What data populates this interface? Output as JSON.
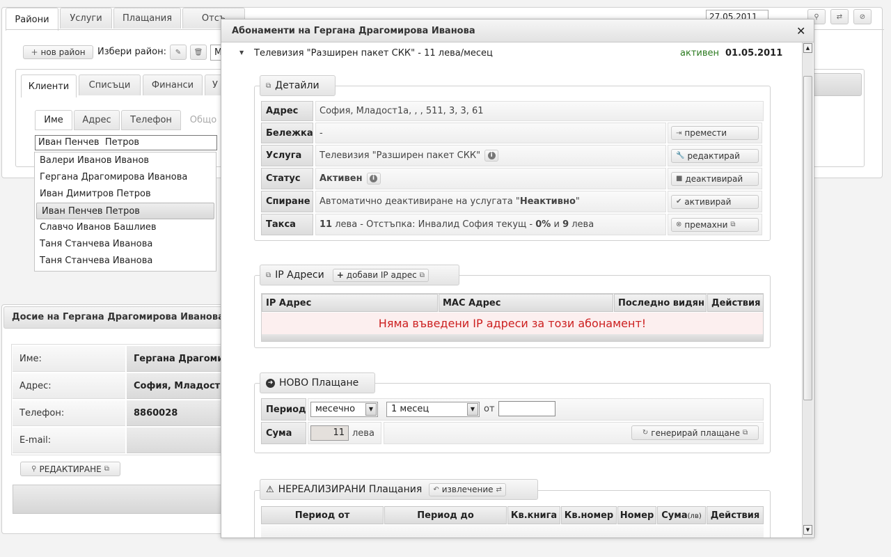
{
  "topTabs": [
    "Райони",
    "Услуги",
    "Плащания",
    "Отсъ"
  ],
  "topDate": "27.05.2011",
  "districtToolbar": {
    "newDistrict": "нов район",
    "chooseDistrict": "Избери район:",
    "selectValue": "М"
  },
  "innerTabs": [
    "Клиенти",
    "Списъци",
    "Финанси",
    "У"
  ],
  "searchTabs": [
    "Име",
    "Адрес",
    "Телефон",
    "Общо"
  ],
  "search": {
    "value": "Иван Пенчев  Петров"
  },
  "autocomplete": [
    "Валери Иванов Иванов",
    "Гергана Драгомирова Иванова",
    "Иван Димитров Петров",
    "Иван Пенчев Петров",
    "Славчо Иванов Башлиев",
    "Таня Станчева Иванова",
    "Таня Станчева Иванова"
  ],
  "dossier": {
    "title": "Досие на Гергана Драгомирова Иванова",
    "rows": [
      {
        "label": "Име:",
        "value": "Гергана Драгоми"
      },
      {
        "label": "Адрес:",
        "value": "София, Младост"
      },
      {
        "label": "Телефон:",
        "value": "8860028"
      },
      {
        "label": "E-mail:",
        "value": ""
      }
    ],
    "editLabel": "РЕДАКТИРАНЕ"
  },
  "modal": {
    "title": "Абонаменти на Гергана Драгомирова Иванова",
    "subscription": {
      "name": "Телевизия \"Разширен пакет СКК\" - 11 лева/месец",
      "status": "активен",
      "date": "01.05.2011"
    },
    "details": {
      "legend": "Детайли",
      "address": {
        "label": "Адрес",
        "value": "София, Младост1а, , , 511, 3, 3, 61"
      },
      "note": {
        "label": "Бележка",
        "value": "-",
        "action": "премести"
      },
      "service": {
        "label": "Услуга",
        "value": "Телевизия \"Разширен пакет СКК\"",
        "action": "редактирай"
      },
      "status": {
        "label": "Статус",
        "value": "Активен",
        "action": "деактивирай"
      },
      "stop": {
        "label": "Спиране",
        "valuePrefix": "Автоматично деактивиране на услугата \"",
        "valueBold": "Неактивно",
        "valueSuffix": "\"",
        "action": "активирай"
      },
      "fee": {
        "label": "Такса",
        "amount": "11",
        "text1": " лева - Отстъпка: Инвалид София текущ - ",
        "pct": "0%",
        "text2": " и ",
        "amount2": "9",
        "text3": " лева",
        "action": "премахни"
      }
    },
    "ip": {
      "legend": "IP Адреси",
      "addButton": "добави IP адрес",
      "headers": [
        "IP Адрес",
        "MAC Адрес",
        "Последно видян",
        "Действия"
      ],
      "empty": "Няма въведени IP адреси за този абонамент!"
    },
    "payment": {
      "legend": "НОВО Плащане",
      "periodLabel": "Период",
      "periodType": "месечно",
      "periodLength": "1 месец",
      "fromLabel": "от",
      "fromValue": "",
      "sumLabel": "Сума",
      "sumValue": "11",
      "currency": "лева",
      "generate": "генерирай плащане"
    },
    "unrealized": {
      "legend": "НЕРЕАЛИЗИРАНИ Плащания",
      "extract": "извлечение",
      "headers": [
        "Период от",
        "Период до",
        "Кв.книга",
        "Кв.номер",
        "Номер",
        "Сума",
        "Действия"
      ],
      "sumUnit": "(лв)"
    }
  }
}
